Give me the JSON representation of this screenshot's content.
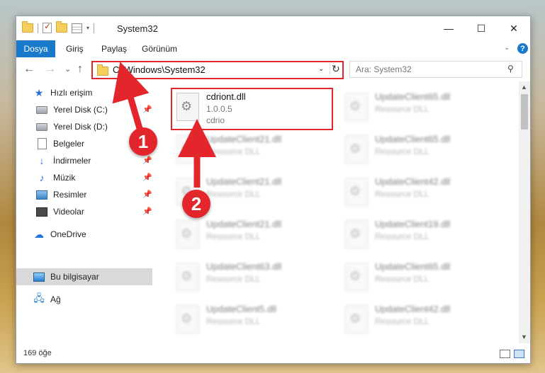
{
  "window": {
    "title": "System32",
    "controls": {
      "minimize": "—",
      "maximize": "☐",
      "close": "✕"
    }
  },
  "ribbon": {
    "tabs": [
      "Dosya",
      "Giriş",
      "Paylaş",
      "Görünüm"
    ],
    "help": "?"
  },
  "nav": {
    "back": "←",
    "forward": "→",
    "recent": "⌄",
    "up": "↑",
    "address": "C:\\Windows\\System32",
    "search_placeholder": "Ara: System32"
  },
  "sidebar": {
    "items": [
      {
        "label": "Hızlı erişim",
        "icon": "star-icon"
      },
      {
        "label": "Yerel Disk (C:)",
        "icon": "drive-icon",
        "pinned": true
      },
      {
        "label": "Yerel Disk (D:)",
        "icon": "drive-icon",
        "pinned": false
      },
      {
        "label": "Belgeler",
        "icon": "document-icon",
        "pinned": true
      },
      {
        "label": "İndirmeler",
        "icon": "download-icon",
        "pinned": true
      },
      {
        "label": "Müzik",
        "icon": "music-icon",
        "pinned": true
      },
      {
        "label": "Resimler",
        "icon": "picture-icon",
        "pinned": true
      },
      {
        "label": "Videolar",
        "icon": "video-icon",
        "pinned": true
      },
      {
        "label": "OneDrive",
        "icon": "cloud-icon"
      },
      {
        "label": "Bu bilgisayar",
        "icon": "computer-icon",
        "selected": true
      },
      {
        "label": "Ağ",
        "icon": "network-icon"
      }
    ]
  },
  "files": {
    "highlighted": {
      "name": "cdriont.dll",
      "version": "1.0.0.5",
      "company": "cdrio"
    },
    "column1": [
      {
        "name": "UpdateClient21.dll",
        "type": "Resource DLL"
      },
      {
        "name": "UpdateClient21.dll",
        "type": "Resource DLL"
      },
      {
        "name": "UpdateClient21.dll",
        "type": "Resource DLL"
      },
      {
        "name": "UpdateClient63.dll",
        "type": "Resource DLL"
      },
      {
        "name": "UpdateClient5.dll",
        "type": "Resource DLL"
      }
    ],
    "column2": [
      {
        "name": "UpdateClient65.dll",
        "type": "Resource DLL"
      },
      {
        "name": "UpdateClient65.dll",
        "type": "Resource DLL"
      },
      {
        "name": "UpdateClient42.dll",
        "type": "Resource DLL"
      },
      {
        "name": "UpdateClient19.dll",
        "type": "Resource DLL"
      },
      {
        "name": "UpdateClient65.dll",
        "type": "Resource DLL"
      },
      {
        "name": "UpdateClient42.dll",
        "type": "Resource DLL"
      }
    ]
  },
  "status": {
    "count": "169 öğe"
  },
  "annotations": {
    "step1": "1",
    "step2": "2",
    "color": "#e3262b"
  }
}
